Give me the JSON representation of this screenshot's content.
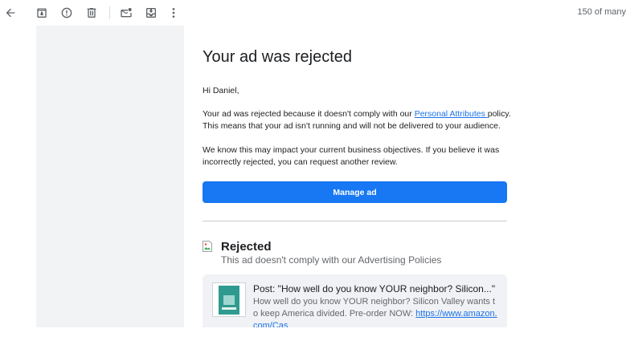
{
  "toolbar": {
    "icons": [
      "back-arrow-icon",
      "archive-icon",
      "report-spam-icon",
      "delete-icon",
      "mark-unread-icon",
      "move-to-icon",
      "more-vert-icon"
    ],
    "pager": "150 of many"
  },
  "email": {
    "title": "Your ad was rejected",
    "greeting": "Hi Daniel,",
    "para1_before": "Your ad was rejected because it doesn't comply with our ",
    "para1_link": "Personal Attributes ",
    "para1_after": "policy. This means that your ad isn't running and will not be delivered to your audience.",
    "para2": "We know this may impact your current business objectives. If you believe it was incorrectly rejected, you can request another review.",
    "cta_label": "Manage ad",
    "status_title": "Rejected",
    "status_subtitle": "This ad doesn't comply with our Advertising Policies",
    "post_title": "Post: \"How well do you know YOUR neighbor? Silicon...\"",
    "post_body": "How well do you know YOUR neighbor? Silicon Valley wants to keep America divided. Pre-order NOW: ",
    "post_link": "https://www.amazon.com/Cas"
  },
  "colors": {
    "cta": "#1877f2",
    "link": "#1a73e8",
    "background": "#f1f3f4"
  }
}
